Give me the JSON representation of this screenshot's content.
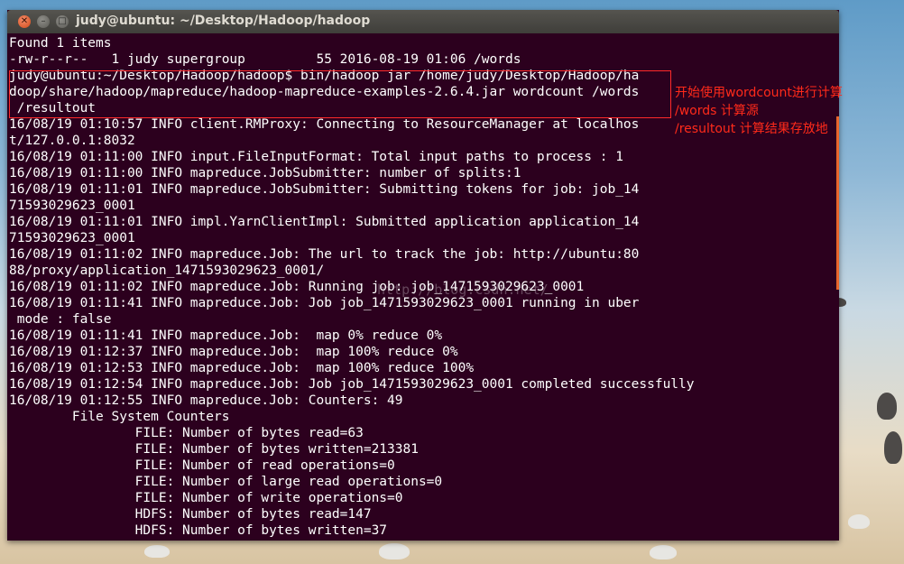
{
  "window": {
    "title": "judy@ubuntu: ~/Desktop/Hadoop/hadoop",
    "close_glyph": "✕",
    "min_glyph": "–",
    "max_glyph": "□"
  },
  "terminal_lines": [
    "Found 1 items",
    "-rw-r--r--   1 judy supergroup         55 2016-08-19 01:06 /words",
    "judy@ubuntu:~/Desktop/Hadoop/hadoop$ bin/hadoop jar /home/judy/Desktop/Hadoop/ha",
    "doop/share/hadoop/mapreduce/hadoop-mapreduce-examples-2.6.4.jar wordcount /words",
    " /resultout",
    "16/08/19 01:10:57 INFO client.RMProxy: Connecting to ResourceManager at localhos",
    "t/127.0.0.1:8032",
    "16/08/19 01:11:00 INFO input.FileInputFormat: Total input paths to process : 1",
    "16/08/19 01:11:00 INFO mapreduce.JobSubmitter: number of splits:1",
    "16/08/19 01:11:01 INFO mapreduce.JobSubmitter: Submitting tokens for job: job_14",
    "71593029623_0001",
    "16/08/19 01:11:01 INFO impl.YarnClientImpl: Submitted application application_14",
    "71593029623_0001",
    "16/08/19 01:11:02 INFO mapreduce.Job: The url to track the job: http://ubuntu:80",
    "88/proxy/application_1471593029623_0001/",
    "16/08/19 01:11:02 INFO mapreduce.Job: Running job: job_1471593029623_0001",
    "16/08/19 01:11:41 INFO mapreduce.Job: Job job_1471593029623_0001 running in uber",
    " mode : false",
    "16/08/19 01:11:41 INFO mapreduce.Job:  map 0% reduce 0%",
    "16/08/19 01:12:37 INFO mapreduce.Job:  map 100% reduce 0%",
    "16/08/19 01:12:53 INFO mapreduce.Job:  map 100% reduce 100%",
    "16/08/19 01:12:54 INFO mapreduce.Job: Job job_1471593029623_0001 completed successfully",
    "16/08/19 01:12:55 INFO mapreduce.Job: Counters: 49",
    "        File System Counters",
    "                FILE: Number of bytes read=63",
    "                FILE: Number of bytes written=213381",
    "                FILE: Number of read operations=0",
    "                FILE: Number of large read operations=0",
    "                FILE: Number of write operations=0",
    "                HDFS: Number of bytes read=147",
    "                HDFS: Number of bytes written=37"
  ],
  "annotation": {
    "line1": "开始使用wordcount进行计算",
    "line2": "/words 计算源",
    "line3": "/resultout 计算结果存放地"
  },
  "watermark": "http://blog.csdn.net/",
  "colors": {
    "terminal_bg": "#2c001e",
    "annotation": "#ff2a1a",
    "scrollbar": "#e8662c"
  }
}
